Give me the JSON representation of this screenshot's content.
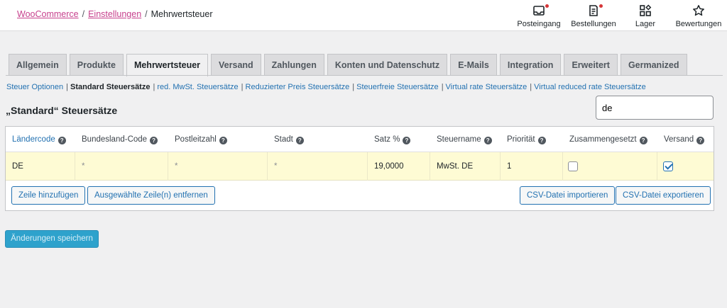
{
  "breadcrumb": {
    "root": "WooCommerce",
    "parent": "Einstellungen",
    "current": "Mehrwertsteuer",
    "sep": "/"
  },
  "toolbar": [
    {
      "label": "Posteingang",
      "icon": "inbox-icon",
      "badge": true
    },
    {
      "label": "Bestellungen",
      "icon": "orders-icon",
      "badge": true
    },
    {
      "label": "Lager",
      "icon": "stock-icon",
      "badge": false
    },
    {
      "label": "Bewertungen",
      "icon": "star-icon",
      "badge": false
    }
  ],
  "tabs": [
    "Allgemein",
    "Produkte",
    "Mehrwertsteuer",
    "Versand",
    "Zahlungen",
    "Konten und Datenschutz",
    "E-Mails",
    "Integration",
    "Erweitert",
    "Germanized"
  ],
  "active_tab": "Mehrwertsteuer",
  "subnav": [
    "Steuer Optionen",
    "Standard Steuersätze",
    "red. MwSt. Steuersätze",
    "Reduzierter Preis Steuersätze",
    "Steuerfreie Steuersätze",
    "Virtual rate Steuersätze",
    "Virtual reduced rate Steuersätze"
  ],
  "subnav_current": "Standard Steuersätze",
  "section_title": "„Standard“ Steuersätze",
  "search": {
    "value": "de"
  },
  "table": {
    "headers": [
      "Ländercode",
      "Bundesland-Code",
      "Postleitzahl",
      "Stadt",
      "Satz %",
      "Steuername",
      "Priorität",
      "Zusammengesetzt",
      "Versand"
    ],
    "rows": [
      {
        "country": "DE",
        "state": "*",
        "postcode": "*",
        "city": "*",
        "rate": "19,0000",
        "name": "MwSt. DE",
        "priority": "1",
        "compound": false,
        "shipping": true
      }
    ]
  },
  "buttons": {
    "add_row": "Zeile hinzufügen",
    "remove_rows": "Ausgewählte Zeile(n) entfernen",
    "import_csv": "CSV-Datei importieren",
    "export_csv": "CSV-Datei exportieren",
    "save": "Änderungen speichern"
  },
  "colors": {
    "link": "#2271b1",
    "breadcrumb_link": "#c7418d",
    "row_highlight": "#fefbd4",
    "save_button": "#2ea2cc"
  }
}
